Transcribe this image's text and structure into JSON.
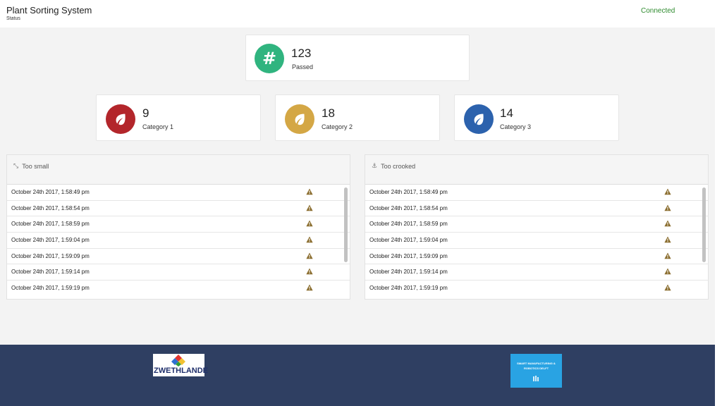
{
  "header": {
    "title": "Plant Sorting System",
    "subtitle": "Status",
    "connection": "Connected"
  },
  "passed": {
    "value": "123",
    "label": "Passed",
    "icon": "hash-icon",
    "color": "#30b47f"
  },
  "categories": [
    {
      "value": "9",
      "label": "Category 1",
      "icon": "leaf-icon",
      "color": "#b3262b"
    },
    {
      "value": "18",
      "label": "Category 2",
      "icon": "leaf-icon",
      "color": "#d4a745"
    },
    {
      "value": "14",
      "label": "Category 3",
      "icon": "leaf-icon",
      "color": "#2c62ad"
    }
  ],
  "panels": [
    {
      "title": "Too small",
      "icon": "compress-icon",
      "rows": [
        "October 24th 2017, 1:58:49 pm",
        "October 24th 2017, 1:58:54 pm",
        "October 24th 2017, 1:58:59 pm",
        "October 24th 2017, 1:59:04 pm",
        "October 24th 2017, 1:59:09 pm",
        "October 24th 2017, 1:59:14 pm",
        "October 24th 2017, 1:59:19 pm"
      ]
    },
    {
      "title": "Too crooked",
      "icon": "anchor-icon",
      "rows": [
        "October 24th 2017, 1:58:49 pm",
        "October 24th 2017, 1:58:54 pm",
        "October 24th 2017, 1:58:59 pm",
        "October 24th 2017, 1:59:04 pm",
        "October 24th 2017, 1:59:09 pm",
        "October 24th 2017, 1:59:14 pm",
        "October 24th 2017, 1:59:19 pm"
      ]
    }
  ],
  "footer": {
    "logo_left_text": "ZWETHLANDE",
    "logo_right_text": "SMART MANUFACTURING & ROBOTICS DELFT"
  }
}
